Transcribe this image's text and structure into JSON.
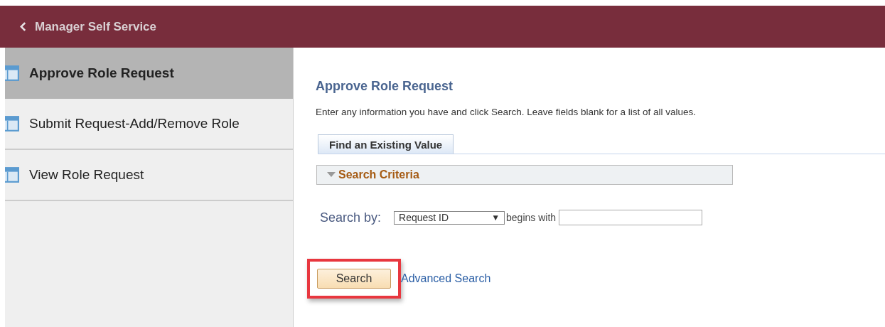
{
  "header": {
    "title": "Manager Self Service"
  },
  "sidebar": {
    "items": [
      {
        "label": "Approve Role Request",
        "selected": true
      },
      {
        "label": "Submit Request-Add/Remove Role",
        "selected": false
      },
      {
        "label": "View Role Request",
        "selected": false
      }
    ]
  },
  "page": {
    "title": "Approve Role Request",
    "instructions": "Enter any information you have and click Search. Leave fields blank for a list of all values.",
    "tabs": [
      {
        "label": "Find an Existing Value",
        "selected": true
      }
    ],
    "section": {
      "title": "Search Criteria",
      "expanded": true
    },
    "search_by": {
      "label": "Search by:",
      "field": "Request ID",
      "caret": "▼",
      "operator": "begins with"
    },
    "search_button": {
      "label": "Search",
      "highlighted": true
    },
    "advanced_link": "Advanced Search"
  }
}
